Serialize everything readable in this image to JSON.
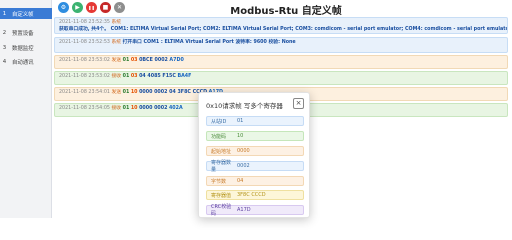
{
  "app": {
    "title": "Modbus-Rtu 自定义帧"
  },
  "sidebar": {
    "items": [
      {
        "num": "1",
        "label": "自定义帧"
      },
      {
        "num": "2",
        "label": "预置设备"
      },
      {
        "num": "3",
        "label": "数据监控"
      },
      {
        "num": "4",
        "label": "自动通讯"
      }
    ]
  },
  "toolbar": {
    "settings_glyph": "⚙",
    "play_glyph": "▶",
    "pause_glyph": "❚❚",
    "stop_glyph": "■",
    "trash_glyph": "✕"
  },
  "log": {
    "entries": [
      {
        "time": "2021-11-08 23:52:35",
        "dir": "系统",
        "text": "获取串口成功, 共4个。 COM1: ELTIMA Virtual Serial Port;  COM2: ELTIMA Virtual Serial Port;  COM3: comdicom - serial port emulator;  COM4: comdicom - serial port emulator;"
      },
      {
        "time": "2021-11-08 23:52:53",
        "dir": "系统",
        "text": "打开串口 COM1 : ELTIMA Virtual Serial Port 波特率: 9600 校验: None"
      },
      {
        "time": "2021-11-08 23:53:02",
        "dir": "发送",
        "addr": "01",
        "fc": "03",
        "body": "0BCE 0002",
        "crc": "A7D0"
      },
      {
        "time": "2021-11-08 23:53:02",
        "dir": "接收",
        "addr": "01",
        "fc": "03",
        "body": "04 4085 F15C",
        "crc": "BA4F"
      },
      {
        "time": "2021-11-08 23:54:01",
        "dir": "发送",
        "addr": "01",
        "fc": "10",
        "body": "0000 0002 04 3F8C CCCD",
        "crc": "A17D"
      },
      {
        "time": "2021-11-08 23:54:05",
        "dir": "接收",
        "addr": "01",
        "fc": "10",
        "body": "0000 0002",
        "crc": "402A"
      }
    ]
  },
  "modal": {
    "title": "0x10请求帧 写多个寄存器",
    "close": "×",
    "fields": [
      {
        "label": "从站ID",
        "value": "01"
      },
      {
        "label": "功能码",
        "value": "10"
      },
      {
        "label": "起始地址",
        "value": "0000"
      },
      {
        "label": "寄存器数量",
        "value": "0002"
      },
      {
        "label": "字节数",
        "value": "04"
      },
      {
        "label": "寄存器值",
        "value": "3F8C CCCD"
      },
      {
        "label": "CRC校验码",
        "value": "A17D"
      }
    ]
  },
  "colors": {
    "accent": "#3a7bd5",
    "settings_btn": "#2e8de0",
    "play_btn": "#3cb371",
    "pause_btn": "#e53935",
    "stop_btn": "#c62828",
    "trash_btn": "#8e8e8e"
  }
}
